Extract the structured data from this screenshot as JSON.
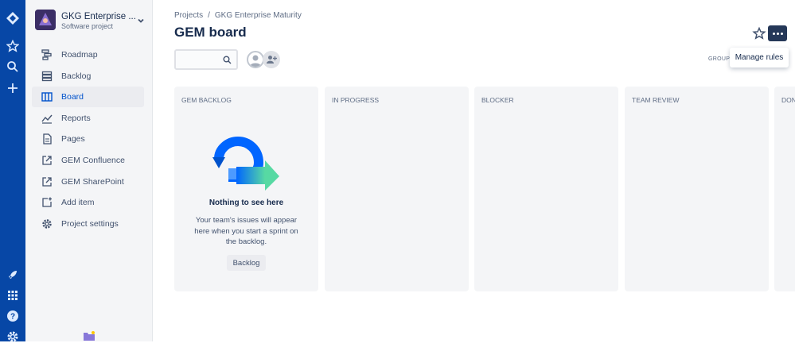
{
  "global_nav": {
    "items": [
      "jira-logo",
      "starred",
      "search",
      "create"
    ],
    "bottom_items": [
      "whats-new",
      "app-switcher",
      "help",
      "settings"
    ]
  },
  "sidebar": {
    "project_name": "GKG Enterprise ...",
    "project_type": "Software project",
    "items": [
      {
        "label": "Roadmap",
        "icon": "roadmap-icon"
      },
      {
        "label": "Backlog",
        "icon": "backlog-icon"
      },
      {
        "label": "Board",
        "icon": "board-icon",
        "active": true
      },
      {
        "label": "Reports",
        "icon": "reports-icon"
      },
      {
        "label": "Pages",
        "icon": "pages-icon"
      },
      {
        "label": "GEM Confluence",
        "icon": "external-link-icon"
      },
      {
        "label": "GEM SharePoint",
        "icon": "external-link-icon"
      },
      {
        "label": "Add item",
        "icon": "add-item-icon"
      },
      {
        "label": "Project settings",
        "icon": "gear-icon"
      }
    ]
  },
  "header": {
    "breadcrumbs": [
      "Projects",
      "GKG Enterprise Maturity"
    ],
    "breadcrumb_sep": "/",
    "title": "GEM board",
    "menu_item": "Manage rules",
    "group_by": "GROUP B"
  },
  "board": {
    "columns": [
      {
        "title": "GEM BACKLOG"
      },
      {
        "title": "IN PROGRESS"
      },
      {
        "title": "BLOCKER"
      },
      {
        "title": "TEAM REVIEW"
      },
      {
        "title": "DONE"
      }
    ],
    "empty_state": {
      "title": "Nothing to see here",
      "description": "Your team's issues will appear here when you start a sprint on the backlog.",
      "button": "Backlog"
    }
  },
  "colors": {
    "global_nav": "#0747a6",
    "sidebar": "#f4f5f7",
    "active_text": "#0052cc",
    "column_bg": "#f4f5f7",
    "more_button": "#253858"
  }
}
